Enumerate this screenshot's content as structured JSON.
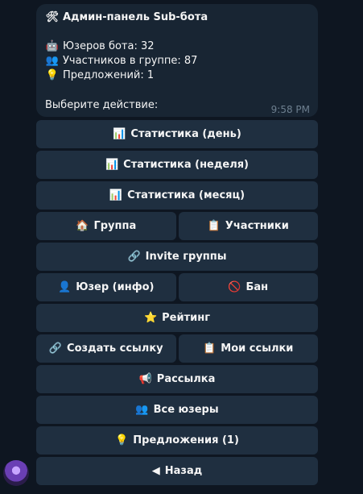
{
  "message": {
    "title": "Админ-панель Sub-бота",
    "title_icon": "🛠",
    "lines": [
      {
        "icon": "🤖",
        "text": "Юзеров бота: 32"
      },
      {
        "icon": "👥",
        "text": "Участников в группе: 87"
      },
      {
        "icon": "💡",
        "text": "Предложений: 1"
      }
    ],
    "prompt": "Выберите действие:",
    "time": "9:58 PM"
  },
  "keyboard": {
    "stats_day": {
      "icon": "📊",
      "label": "Статистика (день)"
    },
    "stats_week": {
      "icon": "📊",
      "label": "Статистика (неделя)"
    },
    "stats_month": {
      "icon": "📊",
      "label": "Статистика (месяц)"
    },
    "group": {
      "icon": "🏠",
      "label": "Группа"
    },
    "members": {
      "icon": "📋",
      "label": "Участники"
    },
    "invite": {
      "icon": "🔗",
      "label": "Invite группы"
    },
    "user_info": {
      "icon": "👤",
      "label": "Юзер (инфо)"
    },
    "ban": {
      "icon": "🚫",
      "label": "Бан"
    },
    "rating": {
      "icon": "⭐",
      "label": "Рейтинг"
    },
    "create_link": {
      "icon": "🔗",
      "label": "Создать ссылку"
    },
    "my_links": {
      "icon": "📋",
      "label": "Мои ссылки"
    },
    "broadcast": {
      "icon": "📢",
      "label": "Рассылка"
    },
    "all_users": {
      "icon": "👥",
      "label": "Все юзеры"
    },
    "suggestions": {
      "icon": "💡",
      "label": "Предложения (1)"
    },
    "back": {
      "icon": "◀",
      "label": "Назад"
    }
  },
  "colors": {
    "background": "#0e1621",
    "bubble": "#182533",
    "button": "#1f2f40",
    "time": "#6d7f8f"
  }
}
